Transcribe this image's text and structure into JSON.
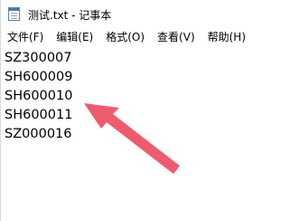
{
  "window": {
    "title": "测试.txt - 记事本"
  },
  "menu": [
    {
      "label": "文件(F)"
    },
    {
      "label": "编辑(E)"
    },
    {
      "label": "格式(O)"
    },
    {
      "label": "查看(V)"
    },
    {
      "label": "帮助(H)"
    }
  ],
  "editor": {
    "lines": [
      "SZ300007",
      "SH600009",
      "SH600010",
      "SH600011",
      "SZ000016"
    ]
  },
  "annotation": {
    "arrow_color": "#f05a6e",
    "arrow_target_line": 3
  }
}
